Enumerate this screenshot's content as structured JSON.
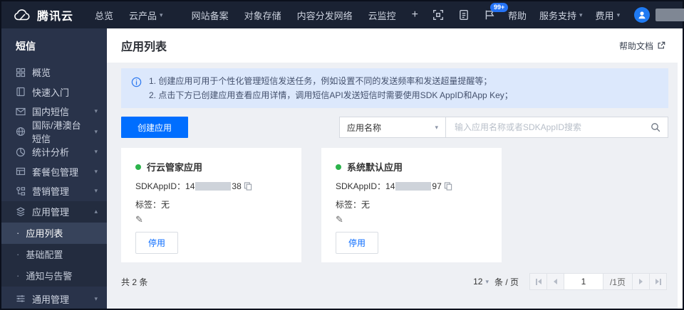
{
  "colors": {
    "accent": "#006eff",
    "topbar_bg": "#1a2233",
    "sidebar_bg": "#29334a",
    "sidebar_active_bg": "#37435b",
    "banner_bg": "#dce8fc",
    "content_bg": "#eef0f4",
    "status_green": "#2bb34b",
    "badge_bg": "#2573f5"
  },
  "glyphs": {
    "caret_down": "▾",
    "caret_up": "▴",
    "pencil": "✎",
    "bullet": "·"
  },
  "topbar": {
    "logo": "腾讯云",
    "nav_overview": "总览",
    "nav_products": "云产品",
    "shortcut_1": "网站备案",
    "shortcut_2": "对象存储",
    "shortcut_3": "内容分发网络",
    "shortcut_4": "云监控",
    "plus": "+",
    "badge": "99+",
    "help": "帮助",
    "support": "服务支持",
    "billing": "费用"
  },
  "sidebar": {
    "title": "短信",
    "items": [
      {
        "label": "概览"
      },
      {
        "label": "快速入门"
      },
      {
        "label": "国内短信"
      },
      {
        "label": "国际/港澳台短信"
      },
      {
        "label": "统计分析"
      },
      {
        "label": "套餐包管理"
      },
      {
        "label": "营销管理"
      },
      {
        "label": "应用管理"
      },
      {
        "label": "通用管理"
      }
    ],
    "submenu": [
      {
        "label": "应用列表"
      },
      {
        "label": "基础配置"
      },
      {
        "label": "通知与告警"
      }
    ]
  },
  "header": {
    "title": "应用列表",
    "help_doc": "帮助文档"
  },
  "banner": {
    "line1": "1. 创建应用可用于个性化管理短信发送任务，例如设置不同的发送频率和发送超量提醒等；",
    "line2": "2. 点击下方已创建应用查看应用详情，调用短信API发送短信时需要使用SDK AppID和App Key；"
  },
  "toolbar": {
    "create_label": "创建应用",
    "filter_selected": "应用名称",
    "search_placeholder": "输入应用名称或者SDKAppID搜索"
  },
  "cards": [
    {
      "name": "行云管家应用",
      "sdk_label": "SDKAppID：",
      "id_prefix": "14",
      "id_suffix": "38",
      "tag_label": "标签：",
      "tag_value": "无",
      "action": "停用"
    },
    {
      "name": "系统默认应用",
      "sdk_label": "SDKAppID：",
      "id_prefix": "14",
      "id_suffix": "97",
      "tag_label": "标签：",
      "tag_value": "无",
      "action": "停用"
    }
  ],
  "footer": {
    "total": "共 2 条",
    "page_size": "12",
    "per_page": "条 / 页",
    "page": "1",
    "page_total": "/1页"
  }
}
